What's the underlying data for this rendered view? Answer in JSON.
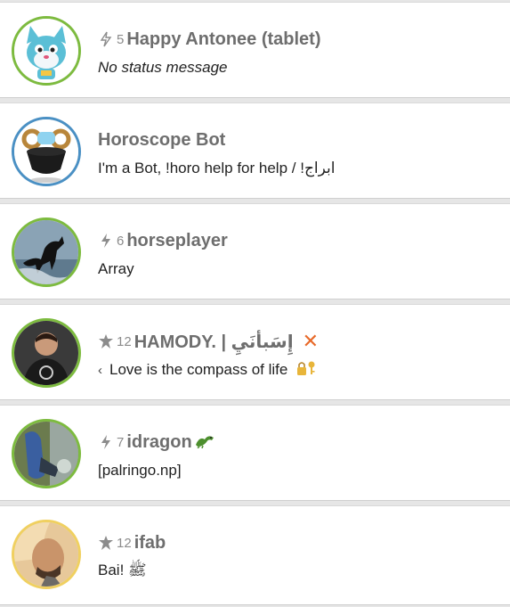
{
  "contacts": [
    {
      "rank": "5",
      "rank_icon": "bolt-outline-icon",
      "name": "Happy Antonee (tablet)",
      "status": "No status message",
      "ring_color": "#7dbb3f"
    },
    {
      "name": "Horoscope Bot",
      "status": "I'm a Bot, !horo help  for help / !ابراج",
      "ring_color": "#4a90c4"
    },
    {
      "rank": "6",
      "rank_icon": "bolt-icon",
      "name": "horseplayer",
      "status": "Array",
      "ring_color": "#7dbb3f"
    },
    {
      "rank": "12",
      "rank_icon": "star-icon",
      "name": "HAMODY. | إِسَبأنَيِ",
      "status": "Love is the compass of life",
      "ring_color": "#7dbb3f"
    },
    {
      "rank": "7",
      "rank_icon": "bolt-icon",
      "name": "idragon",
      "status": "[palringo.np]",
      "ring_color": "#7dbb3f"
    },
    {
      "rank": "12",
      "rank_icon": "star-icon",
      "name": "ifab",
      "status": "Bai! ﷺ",
      "ring_color": "#f0d060"
    }
  ]
}
